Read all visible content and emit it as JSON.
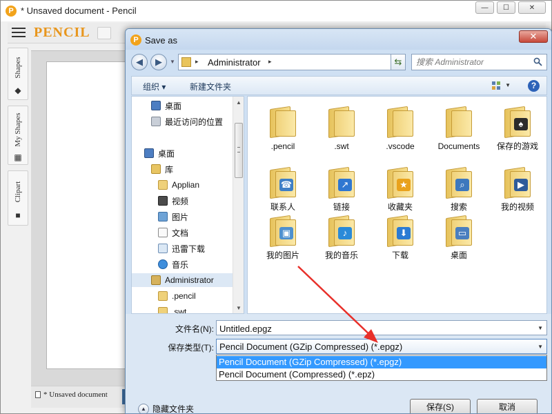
{
  "main_window": {
    "title": "* Unsaved document - Pencil",
    "app_icon": "P",
    "brand": "PENCIL",
    "window_controls": [
      "—",
      "☐",
      "✕"
    ],
    "side_tabs": [
      {
        "label": "Shapes",
        "icon": "diamond-icon"
      },
      {
        "label": "My Shapes",
        "icon": "puzzle-icon"
      },
      {
        "label": "Clipart",
        "icon": "clipart-icon"
      }
    ],
    "document_tab": "* Unsaved document"
  },
  "dialog": {
    "title": "Save as",
    "app_icon": "P",
    "close_label": "✕",
    "address": {
      "path": "Administrator",
      "separator": "▸"
    },
    "search": {
      "placeholder": "搜索 Administrator"
    },
    "command_bar": {
      "organize": "组织 ▾",
      "new_folder": "新建文件夹",
      "help": "?"
    },
    "nav_items": [
      {
        "label": "桌面",
        "icon": "desktop-icon"
      },
      {
        "label": "最近访问的位置",
        "icon": "recent-places-icon"
      },
      {
        "label": "桌面",
        "icon": "desktop-icon"
      },
      {
        "label": "库",
        "icon": "library-icon"
      },
      {
        "label": "Applian",
        "icon": "folder-icon"
      },
      {
        "label": "视频",
        "icon": "video-icon"
      },
      {
        "label": "图片",
        "icon": "pictures-icon"
      },
      {
        "label": "文档",
        "icon": "documents-icon"
      },
      {
        "label": "迅雷下载",
        "icon": "download-icon"
      },
      {
        "label": "音乐",
        "icon": "music-icon"
      },
      {
        "label": "Administrator",
        "icon": "user-folder-icon"
      },
      {
        "label": ".pencil",
        "icon": "folder-icon"
      },
      {
        "label": ".swt",
        "icon": "folder-icon"
      }
    ],
    "files": [
      {
        "label": ".pencil",
        "badge": ""
      },
      {
        "label": ".swt",
        "badge": ""
      },
      {
        "label": ".vscode",
        "badge": ""
      },
      {
        "label": "Documents",
        "badge": ""
      },
      {
        "label": "保存的游戏",
        "badge": "♠"
      },
      {
        "label": "联系人",
        "badge": "☎"
      },
      {
        "label": "链接",
        "badge": "↗"
      },
      {
        "label": "收藏夹",
        "badge": "★"
      },
      {
        "label": "搜索",
        "badge": "⌕"
      },
      {
        "label": "我的视频",
        "badge": "▶"
      },
      {
        "label": "我的图片",
        "badge": "▣"
      },
      {
        "label": "我的音乐",
        "badge": "♪"
      },
      {
        "label": "下载",
        "badge": "⬇"
      },
      {
        "label": "桌面",
        "badge": "▭"
      }
    ],
    "filename_label": "文件名(N):",
    "filename_value": "Untitled.epgz",
    "filetype_label": "保存类型(T):",
    "filetype_value": "Pencil Document (GZip Compressed) (*.epgz)",
    "filetype_options": [
      "Pencil Document (GZip Compressed) (*.epgz)",
      "Pencil Document (Compressed) (*.epz)"
    ],
    "hide_folders": "隐藏文件夹",
    "save_button": "保存(S)",
    "cancel_button": "取消"
  },
  "colors": {
    "accent": "#3399ff",
    "brand": "#e8961d",
    "annotation_arrow": "#e8302a"
  }
}
